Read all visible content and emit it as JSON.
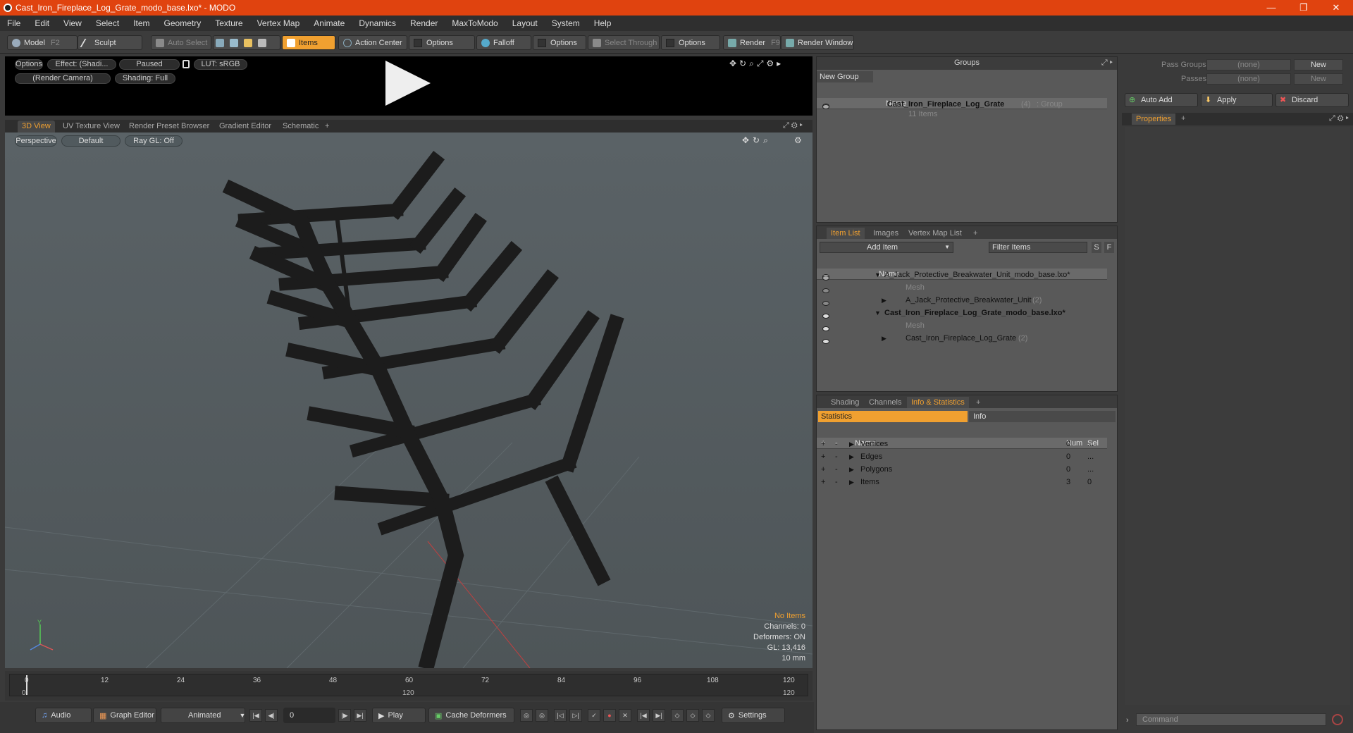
{
  "window": {
    "title": "Cast_Iron_Fireplace_Log_Grate_modo_base.lxo* - MODO"
  },
  "menu": [
    "File",
    "Edit",
    "View",
    "Select",
    "Item",
    "Geometry",
    "Texture",
    "Vertex Map",
    "Animate",
    "Dynamics",
    "Render",
    "MaxToModo",
    "Layout",
    "System",
    "Help"
  ],
  "toolbar": {
    "model": "Model",
    "model_key": "F2",
    "sculpt": "Sculpt",
    "auto_select": "Auto Select",
    "items": "Items",
    "action_center": "Action Center",
    "options1": "Options",
    "falloff": "Falloff",
    "options2": "Options",
    "select_through": "Select Through",
    "options3": "Options",
    "render": "Render",
    "render_key": "F9",
    "render_window": "Render Window"
  },
  "preview": {
    "options": "Options",
    "effect": "Effect: (Shadi...",
    "paused": "Paused",
    "lut": "LUT: sRGB",
    "camera": "(Render Camera)",
    "shading": "Shading: Full"
  },
  "viewport_tabs": [
    "3D View",
    "UV Texture View",
    "Render Preset Browser",
    "Gradient Editor",
    "Schematic",
    "+"
  ],
  "viewport": {
    "perspective": "Perspective",
    "default": "Default",
    "raygl": "Ray GL: Off",
    "stats": {
      "no_items": "No Items",
      "channels": "Channels: 0",
      "deformers": "Deformers: ON",
      "gl": "GL: 13,416",
      "scale": "10 mm"
    },
    "axis_y": "Y",
    "axis_x": "X",
    "axis_z": "Z"
  },
  "timeline": {
    "ticks": [
      "0",
      "12",
      "24",
      "36",
      "48",
      "60",
      "72",
      "84",
      "96",
      "108",
      "120"
    ],
    "start": "0",
    "mid": "120",
    "end": "120"
  },
  "bottombar": {
    "audio": "Audio",
    "graph_editor": "Graph Editor",
    "animated": "Animated",
    "frame": "0",
    "play": "Play",
    "cache_deformers": "Cache Deformers",
    "settings": "Settings"
  },
  "groups": {
    "title": "Groups",
    "new_group": "New Group",
    "col_name": "Name",
    "item_name": "Cast_Iron_Fireplace_Log_Grate",
    "item_count": "(4)",
    "item_type": ": Group",
    "item_sub": "11 Items"
  },
  "itemlist": {
    "tabs": [
      "Item List",
      "Images",
      "Vertex Map List",
      "+"
    ],
    "add_item": "Add Item",
    "filter": "Filter Items",
    "col_name": "Name",
    "rows": [
      {
        "label": "A_Jack_Protective_Breakwater_Unit_modo_base.lxo*",
        "suffix": ""
      },
      {
        "label": "Mesh",
        "suffix": ""
      },
      {
        "label": "A_Jack_Protective_Breakwater_Unit",
        "suffix": "(2)"
      },
      {
        "label": "Cast_Iron_Fireplace_Log_Grate_modo_base.lxo*",
        "suffix": ""
      },
      {
        "label": "Mesh",
        "suffix": ""
      },
      {
        "label": "Cast_Iron_Fireplace_Log_Grate",
        "suffix": "(2)"
      }
    ]
  },
  "stats": {
    "tabs": [
      "Shading",
      "Channels",
      "Info & Statistics",
      "+"
    ],
    "sub_statistics": "Statistics",
    "sub_info": "Info",
    "col_name": "Name",
    "col_num": "Num",
    "col_sel": "Sel",
    "rows": [
      {
        "name": "Vertices",
        "num": "0",
        "sel": "..."
      },
      {
        "name": "Edges",
        "num": "0",
        "sel": "..."
      },
      {
        "name": "Polygons",
        "num": "0",
        "sel": "..."
      },
      {
        "name": "Items",
        "num": "3",
        "sel": "0"
      }
    ]
  },
  "properties": {
    "pass_groups": "Pass Groups",
    "pass_groups_val": "(none)",
    "new1": "New",
    "passes": "Passes",
    "passes_val": "(none)",
    "new2": "New",
    "auto_add": "Auto Add",
    "apply": "Apply",
    "discard": "Discard",
    "tab": "Properties",
    "command": "Command"
  },
  "colors": {
    "accent": "#f0a030",
    "titlebar": "#e0430f"
  }
}
